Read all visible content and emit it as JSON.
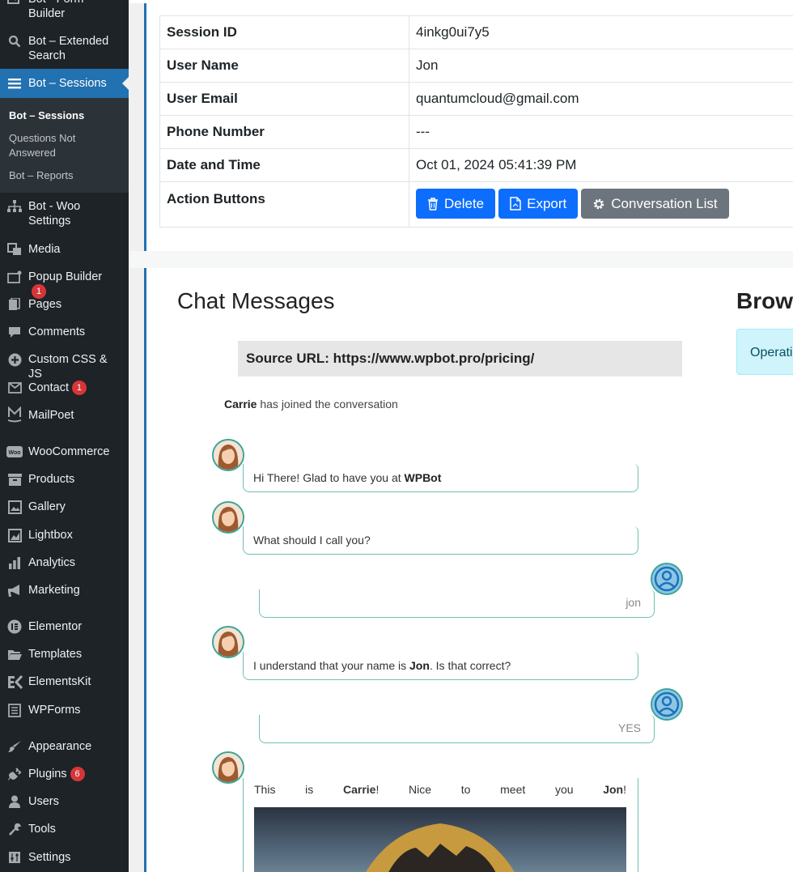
{
  "sidebar": {
    "items": [
      {
        "label": "Bot - Form Builder",
        "icon": "form-icon"
      },
      {
        "label": "Bot – Extended Search",
        "icon": "search-icon"
      },
      {
        "label": "Bot – Sessions",
        "icon": "list-icon"
      },
      {
        "label": "Bot - Woo Settings",
        "icon": "network-icon"
      },
      {
        "label": "Media",
        "icon": "media-icon"
      },
      {
        "label": "Popup Builder",
        "icon": "popup-icon",
        "badge": "1"
      },
      {
        "label": "Pages",
        "icon": "pages-icon"
      },
      {
        "label": "Comments",
        "icon": "comment-icon"
      },
      {
        "label": "Custom CSS & JS",
        "icon": "plus-circle-icon"
      },
      {
        "label": "Contact",
        "icon": "mail-icon",
        "badge": "1"
      },
      {
        "label": "MailPoet",
        "icon": "mailpoet-icon"
      },
      {
        "label": "WooCommerce",
        "icon": "woo-icon"
      },
      {
        "label": "Products",
        "icon": "archive-icon"
      },
      {
        "label": "Gallery",
        "icon": "gallery-icon"
      },
      {
        "label": "Lightbox",
        "icon": "lightbox-icon"
      },
      {
        "label": "Analytics",
        "icon": "bar-chart-icon"
      },
      {
        "label": "Marketing",
        "icon": "megaphone-icon"
      },
      {
        "label": "Elementor",
        "icon": "elementor-icon"
      },
      {
        "label": "Templates",
        "icon": "folder-icon"
      },
      {
        "label": "ElementsKit",
        "icon": "elementskit-icon"
      },
      {
        "label": "WPForms",
        "icon": "wpforms-icon"
      },
      {
        "label": "Appearance",
        "icon": "brush-icon"
      },
      {
        "label": "Plugins",
        "icon": "plugin-icon",
        "badge": "6"
      },
      {
        "label": "Users",
        "icon": "user-icon"
      },
      {
        "label": "Tools",
        "icon": "wrench-icon"
      },
      {
        "label": "Settings",
        "icon": "settings-icon"
      }
    ],
    "submenu": [
      {
        "label": "Bot – Sessions"
      },
      {
        "label": "Questions Not Answered"
      },
      {
        "label": "Bot – Reports"
      }
    ]
  },
  "details": {
    "rows": [
      {
        "key": "Session ID",
        "value": "4inkg0ui7y5"
      },
      {
        "key": "User Name",
        "value": "Jon"
      },
      {
        "key": "User Email",
        "value": "quantumcloud@gmail.com"
      },
      {
        "key": "Phone Number",
        "value": "---"
      },
      {
        "key": "Date and Time",
        "value": "Oct 01, 2024 05:41:39 PM"
      }
    ],
    "action_label": "Action Buttons",
    "buttons": {
      "delete": "Delete",
      "export": "Export",
      "conversation_list": "Conversation List"
    }
  },
  "chat": {
    "title": "Chat Messages",
    "source_url": "Source URL: https://www.wpbot.pro/pricing/",
    "joined_name": "Carrie",
    "joined_text": "has joined the conversation",
    "messages": [
      {
        "from": "bot",
        "pre": "Hi There! Glad to have you at ",
        "bold": "WPBot",
        "post": ""
      },
      {
        "from": "bot",
        "pre": "What should I call you?",
        "bold": "",
        "post": ""
      },
      {
        "from": "user",
        "pre": "jon",
        "bold": "",
        "post": ""
      },
      {
        "from": "bot",
        "pre": "I understand that your name is ",
        "bold": "Jon",
        "post": ". Is that correct?"
      },
      {
        "from": "user",
        "pre": "YES",
        "bold": "",
        "post": ""
      }
    ],
    "last": {
      "pre": "This is ",
      "bold1": "Carrie",
      "mid": "! Nice to meet you ",
      "bold2": "Jon",
      "post": "!"
    }
  },
  "browser": {
    "title": "Browser",
    "box_text": "Operating System"
  },
  "colors": {
    "sidebar_bg": "#1d2327",
    "accent": "#2271b1",
    "btn_blue": "#0d6efd",
    "btn_grey": "#6c757d",
    "bubble_border": "#6fc0b4"
  }
}
